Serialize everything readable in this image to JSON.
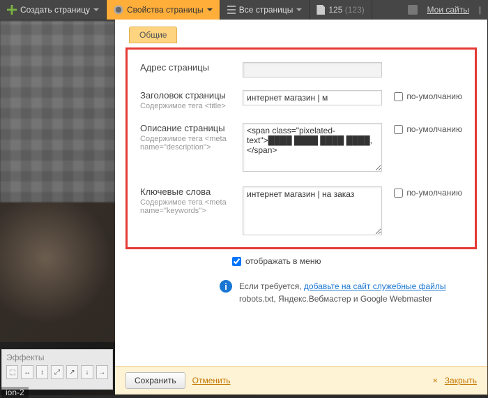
{
  "toolbar": {
    "create": "Создать страницу",
    "properties": "Свойства страницы",
    "all_pages": "Все страницы",
    "page_count": "125",
    "page_count_dim": "(123)",
    "my_sites": "Мои сайты"
  },
  "tabs": {
    "general": "Общие"
  },
  "fields": {
    "address": {
      "label": "Адрес страницы",
      "value": ""
    },
    "title": {
      "label": "Заголовок страницы",
      "sub": "Содержимое тега <title>",
      "value": "интернет магазин | м",
      "default": "по-умолчанию"
    },
    "description": {
      "label": "Описание страницы",
      "sub": "Содержимое тега <meta name=\"description\">",
      "value": "",
      "default": "по-умолчанию"
    },
    "keywords": {
      "label": "Ключевые слова",
      "sub": "Содержимое тега <meta name=\"keywords\">",
      "value": "интернет магазин | на заказ",
      "default": "по-умолчанию"
    }
  },
  "menu_check": "отображать в меню",
  "info": {
    "prefix": "Если требуется, ",
    "link": "добавьте на сайт служебные файлы",
    "line2": "robots.txt, Яндекс.Вебмастер и Google Webmaster"
  },
  "footer": {
    "save": "Сохранить",
    "cancel": "Отменить",
    "close": "Закрыть"
  },
  "effects": {
    "title": "Эффекты"
  },
  "section_label": "ion-2"
}
